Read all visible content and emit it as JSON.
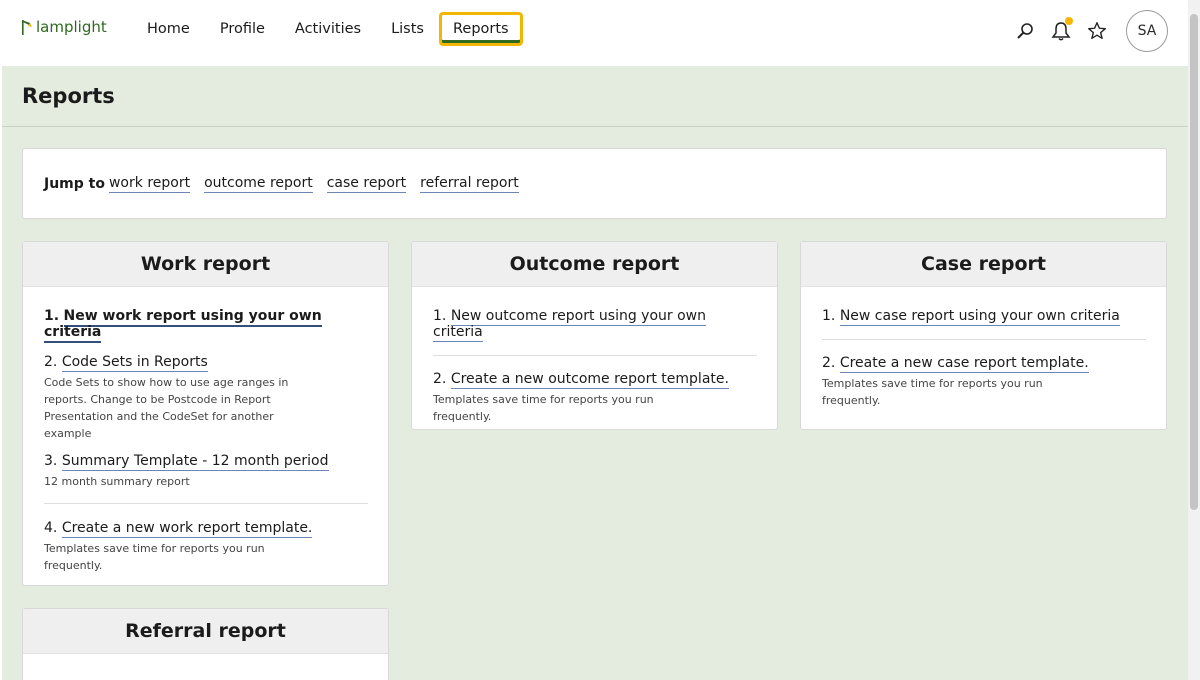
{
  "app": {
    "logo_text": "lamplight"
  },
  "nav": {
    "items": [
      {
        "label": "Home"
      },
      {
        "label": "Profile"
      },
      {
        "label": "Activities"
      },
      {
        "label": "Lists"
      },
      {
        "label": "Reports",
        "active": true
      }
    ]
  },
  "header": {
    "icons": [
      "search-icon",
      "bell-icon",
      "star-icon"
    ],
    "avatar_initials": "SA",
    "notification_dot_color": "#f5b400"
  },
  "page": {
    "title": "Reports"
  },
  "jump": {
    "label": "Jump to",
    "links": [
      "work report",
      "outcome report",
      "case report",
      "referral report"
    ]
  },
  "cards": {
    "work": {
      "title": "Work report",
      "items": [
        {
          "num": "1.",
          "label": "New work report using your own criteria"
        },
        {
          "num": "2.",
          "label": "Code Sets in Reports",
          "desc": "Code Sets to show how to use age ranges in reports. Change to be Postcode in Report Presentation and the CodeSet for another example"
        },
        {
          "num": "3.",
          "label": "Summary Template - 12 month period",
          "desc": "12 month summary report"
        },
        {
          "num": "4.",
          "label": "Create a new work report template.",
          "desc": "Templates save time for reports you run frequently."
        }
      ]
    },
    "outcome": {
      "title": "Outcome report",
      "items": [
        {
          "num": "1.",
          "label": "New outcome report using your own criteria"
        },
        {
          "num": "2.",
          "label": "Create a new outcome report template.",
          "desc": "Templates save time for reports you run frequently."
        }
      ]
    },
    "case": {
      "title": "Case report",
      "items": [
        {
          "num": "1.",
          "label": "New case report using your own criteria"
        },
        {
          "num": "2.",
          "label": "Create a new case report template.",
          "desc": "Templates save time for reports you run frequently."
        }
      ]
    },
    "referral": {
      "title": "Referral report"
    }
  },
  "colors": {
    "brand_green": "#2f6a1f",
    "focus_yellow": "#f2b705",
    "page_bg": "#e4ece0",
    "link_underline": "#6b86b5"
  }
}
